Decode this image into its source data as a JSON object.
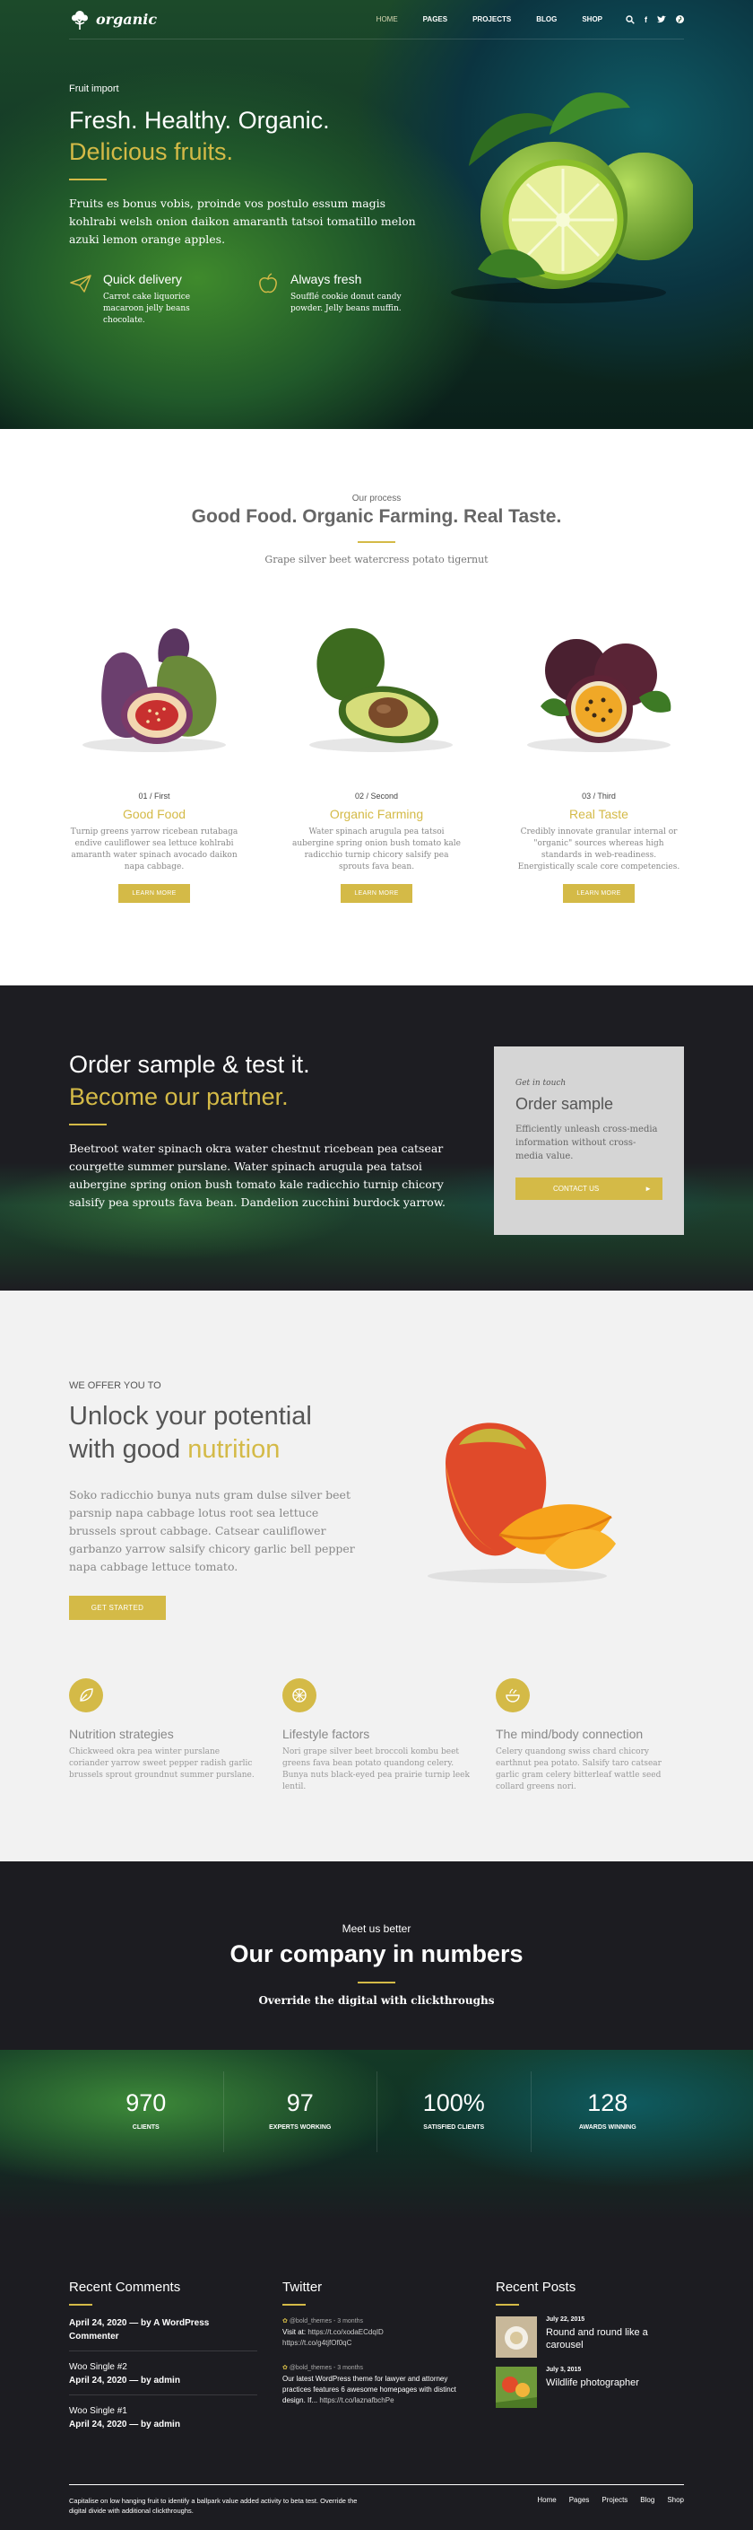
{
  "nav": {
    "logo": "organic",
    "items": [
      {
        "label": "HOME",
        "active": true
      },
      {
        "label": "PAGES"
      },
      {
        "label": "PROJECTS"
      },
      {
        "label": "BLOG"
      },
      {
        "label": "SHOP"
      }
    ],
    "icons": [
      "search-icon",
      "facebook-icon",
      "twitter-icon",
      "pinterest-icon"
    ]
  },
  "hero": {
    "kicker": "Fruit import",
    "title_line1": "Fresh. Healthy. Organic.",
    "title_line2": "Delicious fruits.",
    "paragraph": "Fruits es bonus vobis, proinde vos postulo essum magis kohlrabi welsh onion daikon amaranth tatsoi tomatillo melon azuki lemon orange apples.",
    "features": [
      {
        "title": "Quick delivery",
        "desc": "Carrot cake liquorice macaroon jelly beans chocolate.",
        "icon": "paper-plane-icon"
      },
      {
        "title": "Always fresh",
        "desc": "Soufflé cookie donut candy powder. Jelly beans muffin.",
        "icon": "apple-icon"
      }
    ]
  },
  "process": {
    "kicker": "Our process",
    "title": "Good Food. Organic Farming. Real Taste.",
    "subtitle": "Grape silver beet watercress potato tigernut",
    "steps": [
      {
        "num": "01 / First",
        "title": "Good Food",
        "desc": "Turnip greens yarrow ricebean rutabaga endive cauliflower sea lettuce kohlrabi amaranth water spinach avocado daikon napa cabbage.",
        "button": "LEARN MORE"
      },
      {
        "num": "02 / Second",
        "title": "Organic Farming",
        "desc": "Water spinach arugula pea tatsoi aubergine spring onion bush tomato kale radicchio turnip chicory salsify pea sprouts fava bean.",
        "button": "LEARN MORE"
      },
      {
        "num": "03 / Third",
        "title": "Real Taste",
        "desc": "Credibly innovate granular internal or \"organic\" sources whereas high standards in web-readiness. Energistically scale core competencies.",
        "button": "LEARN MORE"
      }
    ]
  },
  "partner": {
    "title_line1": "Order sample & test it.",
    "title_line2": "Become our partner.",
    "paragraph": "Beetroot water spinach okra water chestnut ricebean pea catsear courgette summer purslane. Water spinach arugula pea tatsoi aubergine spring onion bush tomato kale radicchio turnip chicory salsify pea sprouts fava bean. Dandelion zucchini burdock yarrow.",
    "box": {
      "kicker": "Get in touch",
      "title": "Order sample",
      "desc": "Efficiently unleash cross-media information without cross-media value.",
      "button": "CONTACT US"
    }
  },
  "potential": {
    "kicker": "WE OFFER YOU TO",
    "title_line1": "Unlock your potential",
    "title_line2_a": "with good ",
    "title_line2_b": "nutrition",
    "paragraph": "Soko radicchio bunya nuts gram dulse silver beet parsnip napa cabbage lotus root sea lettuce brussels sprout cabbage. Catsear cauliflower garbanzo yarrow salsify chicory garlic bell pepper napa cabbage lettuce tomato.",
    "button": "GET STARTED",
    "pillars": [
      {
        "title": "Nutrition strategies",
        "desc": "Chickweed okra pea winter purslane coriander yarrow sweet pepper radish garlic brussels sprout groundnut summer purslane.",
        "icon": "leaf-icon"
      },
      {
        "title": "Lifestyle factors",
        "desc": "Nori grape silver beet broccoli kombu beet greens fava bean potato quandong celery. Bunya nuts black-eyed pea prairie turnip leek lentil.",
        "icon": "lemon-icon"
      },
      {
        "title": "The mind/body connection",
        "desc": "Celery quandong swiss chard chicory earthnut pea potato. Salsify taro catsear garlic gram celery bitterleaf wattle seed collard greens nori.",
        "icon": "bowl-icon"
      }
    ]
  },
  "numbers": {
    "kicker": "Meet us better",
    "title": "Our company in numbers",
    "subtitle": "Override the digital with clickthroughs",
    "counters": [
      {
        "value": "970",
        "label": "CLIENTS"
      },
      {
        "value": "97",
        "label": "EXPERTS WORKING"
      },
      {
        "value": "100%",
        "label": "SATISFIED CLIENTS"
      },
      {
        "value": "128",
        "label": "AWARDS WINNING"
      }
    ]
  },
  "footer": {
    "comments_title": "Recent Comments",
    "comments": [
      {
        "lead": "April 24, 2020",
        "by": " — by A WordPress Commenter"
      },
      {
        "post": "Woo Single #2",
        "lead": "April 24, 2020",
        "by": " — by admin"
      },
      {
        "post": "Woo Single #1",
        "lead": "April 24, 2020",
        "by": " — by admin"
      }
    ],
    "twitter_title": "Twitter",
    "tweets": [
      {
        "meta": "@bold_themes - 3 months",
        "text": "Visit at:",
        "link": "https://t.co/xodaECdqID",
        "link2": "https://t.co/g4tjfOf0qC"
      },
      {
        "meta": "@bold_themes - 3 months",
        "text": "Our latest WordPress theme for lawyer and attorney practices features 6 awesome homepages with distinct design. If...",
        "link": "https://t.co/laznafbchPe"
      }
    ],
    "posts_title": "Recent Posts",
    "posts": [
      {
        "date": "July 22, 2015",
        "title": "Round and round like a carousel"
      },
      {
        "date": "July 3, 2015",
        "title": "Wildlife photographer"
      }
    ],
    "bottom_text": "Capitalise on low hanging fruit to identify a ballpark value added activity to beta test. Override the digital divide with additional clickthroughs.",
    "bottom_menu": [
      "Home",
      "Pages",
      "Projects",
      "Blog",
      "Shop"
    ]
  },
  "colors": {
    "accent": "#d4ba47",
    "dark": "#1c1c21",
    "light_bg": "#f2f2f2"
  }
}
